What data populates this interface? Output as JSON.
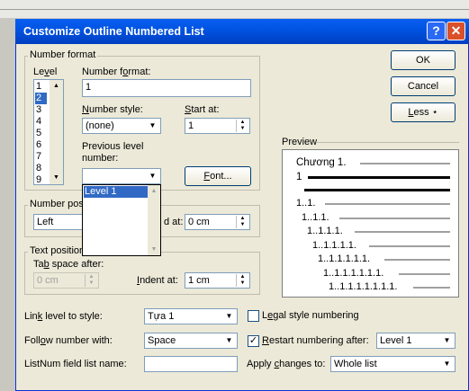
{
  "dialog": {
    "title": "Customize Outline Numbered List",
    "help_icon": "?",
    "close_icon": "✕"
  },
  "number_format": {
    "group_label": "Number format",
    "level_label": "Level",
    "levels": [
      "1",
      "2",
      "3",
      "4",
      "5",
      "6",
      "7",
      "8",
      "9"
    ],
    "selected_level": "2",
    "number_format_label": "Number format:",
    "number_format_value": "1",
    "number_style_label": "Number style:",
    "number_style_value": "(none)",
    "start_at_label": "Start at:",
    "start_at_value": "1",
    "prev_level_label_1": "Previous level",
    "prev_level_label_2": "number:",
    "prev_level_value": "",
    "font_button": "Font...",
    "dropdown_items": [
      "Level 1"
    ]
  },
  "number_position": {
    "group_label": "Number pos",
    "value": "Left",
    "aligned_at_label": "d at:",
    "aligned_at_value": "0 cm"
  },
  "text_position": {
    "group_label": "Text position",
    "tab_space_label": "Tab space after:",
    "tab_space_value": "0 cm",
    "indent_label": "Indent at:",
    "indent_value": "1 cm"
  },
  "buttons": {
    "ok": "OK",
    "cancel": "Cancel",
    "less": "Less ⋆"
  },
  "preview": {
    "label": "Preview",
    "lines": [
      "Chương 1.",
      "1",
      "1..1.",
      "1..1.1.",
      "1..1.1.1.",
      "1..1.1.1.1.",
      "1..1.1.1.1.1.",
      "1..1.1.1.1.1.1.",
      "1..1.1.1.1.1.1.1."
    ]
  },
  "bottom": {
    "link_level_label": "Link level to style:",
    "link_level_value": "Tựa 1",
    "follow_number_label": "Follow number with:",
    "follow_number_value": "Space",
    "listnum_label": "ListNum field list name:",
    "listnum_value": "",
    "legal_label": "Legal style numbering",
    "legal_checked": false,
    "restart_label": "Restart numbering after:",
    "restart_checked": true,
    "restart_value": "Level 1",
    "apply_label": "Apply changes to:",
    "apply_value": "Whole list"
  }
}
